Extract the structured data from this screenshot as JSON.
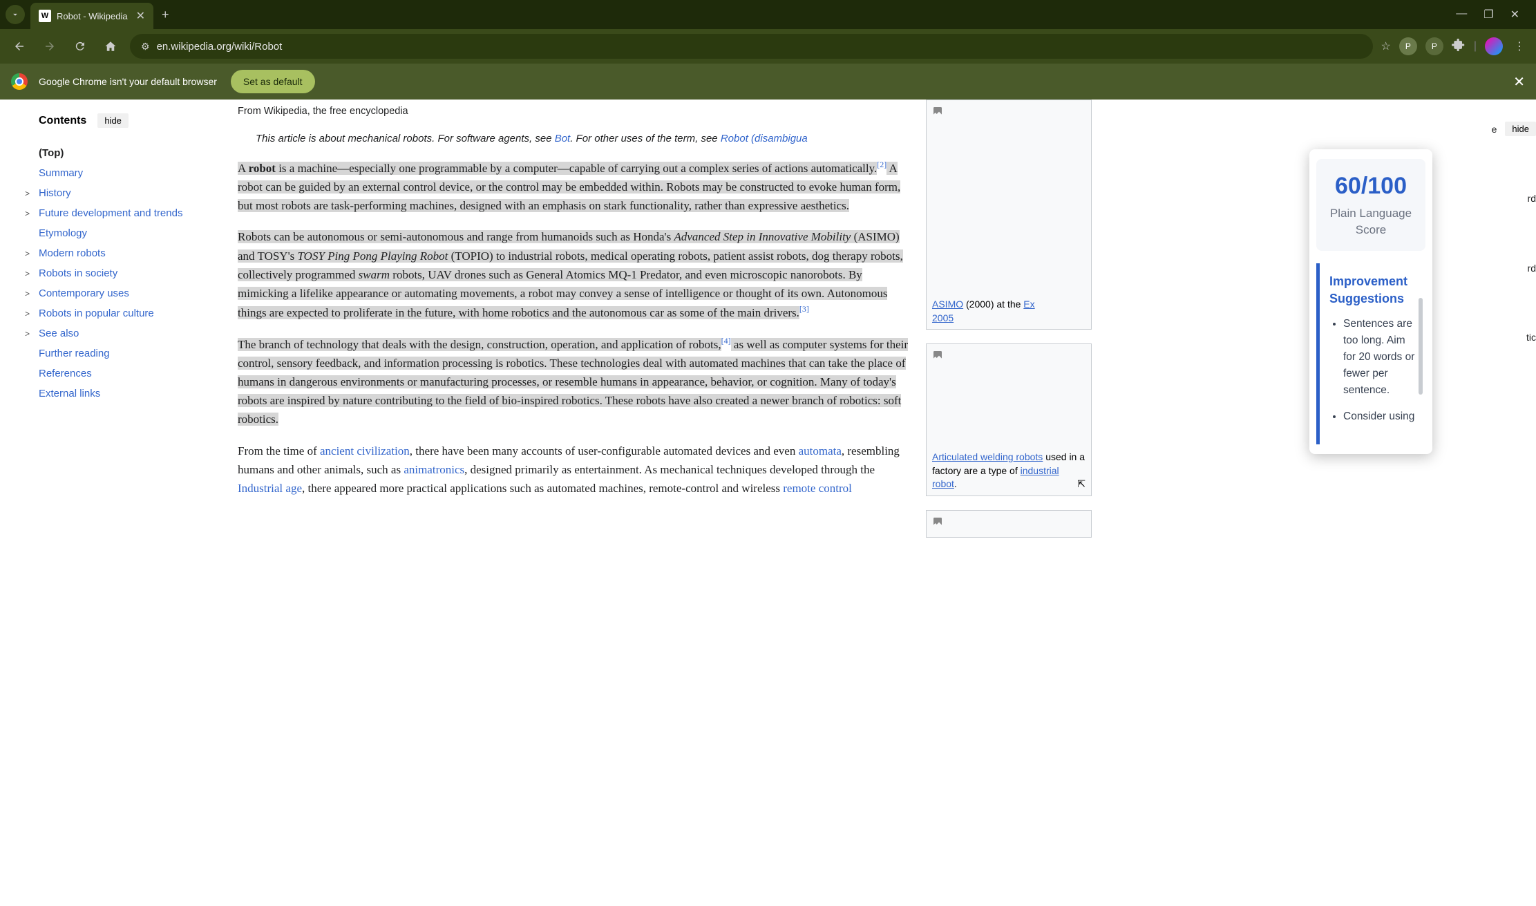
{
  "browser": {
    "tab_title": "Robot - Wikipedia",
    "tab_favicon_letter": "W",
    "url": "en.wikipedia.org/wiki/Robot",
    "profile_letter": "P",
    "window_min": "—",
    "window_max": "⬒",
    "window_close": "✕"
  },
  "infobar": {
    "message": "Google Chrome isn't your default browser",
    "button": "Set as default"
  },
  "toc": {
    "title": "Contents",
    "hide": "hide",
    "items": [
      {
        "label": "(Top)",
        "top": true,
        "chev": false
      },
      {
        "label": "Summary",
        "chev": false
      },
      {
        "label": "History",
        "chev": true
      },
      {
        "label": "Future development and trends",
        "chev": true
      },
      {
        "label": "Etymology",
        "chev": false
      },
      {
        "label": "Modern robots",
        "chev": true
      },
      {
        "label": "Robots in society",
        "chev": true
      },
      {
        "label": "Contemporary uses",
        "chev": true
      },
      {
        "label": "Robots in popular culture",
        "chev": true
      },
      {
        "label": "See also",
        "chev": true
      },
      {
        "label": "Further reading",
        "chev": false
      },
      {
        "label": "References",
        "chev": false
      },
      {
        "label": "External links",
        "chev": false
      }
    ]
  },
  "article": {
    "from_line": "From Wikipedia, the free encyclopedia",
    "hatnote_pre": "This article is about mechanical robots. For software agents, see ",
    "hatnote_link1": "Bot",
    "hatnote_mid": ". For other uses of the term, see ",
    "hatnote_link2": "Robot (disambigua",
    "p1_a": "A ",
    "p1_robot": "robot",
    "p1_b": " is a machine—especially one programmable by a computer—capable of carrying out a complex series of actions automatically.",
    "p1_ref2": "[2]",
    "p1_c": " A robot can be guided by an external control device, or the control may be embedded within. Robots may be constructed to evoke human form, but most robots are task-performing machines, designed with an emphasis on stark functionality, rather than expressive aesthetics.",
    "p2_a": "Robots can be autonomous or semi-autonomous and range from humanoids such as Honda's ",
    "p2_asimo": "Advanced Step in Innovative Mobility",
    "p2_b": " (ASIMO) and TOSY's ",
    "p2_topio": "TOSY Ping Pong Playing Robot",
    "p2_c": " (TOPIO) to industrial robots, medical operating robots, patient assist robots, dog therapy robots, collectively programmed ",
    "p2_swarm": "swarm",
    "p2_d": " robots, UAV drones such as General Atomics MQ-1 Predator, and even microscopic nanorobots. By mimicking a lifelike appearance or automating movements, a robot may convey a sense of intelligence or thought of its own. Autonomous things are expected to proliferate in the future, with home robotics and the autonomous car as some of the main drivers.",
    "p2_ref3": "[3]",
    "p3_a": "The branch of technology that deals with the design, construction, operation, and application of robots,",
    "p3_ref4": "[4]",
    "p3_b": " as well as computer systems for their control, sensory feedback, and information processing is robotics. These technologies deal with automated machines that can take the place of humans in dangerous environments or manufacturing processes, or resemble humans in appearance, behavior, or cognition. Many of today's robots are inspired by nature contributing to the field of bio-inspired robotics. These robots have also created a newer branch of robotics: soft robotics.",
    "p4_a": "From the time of ",
    "p4_link1": "ancient civilization",
    "p4_b": ", there have been many accounts of user-configurable automated devices and even ",
    "p4_link2": "automata",
    "p4_c": ", resembling humans and other animals, such as ",
    "p4_link3": "animatronics",
    "p4_d": ", designed primarily as entertainment. As mechanical techniques developed through the ",
    "p4_link4": "Industrial age",
    "p4_e": ", there appeared more practical applications such as automated machines, remote-control and wireless ",
    "p4_link5": "remote control"
  },
  "infobox": {
    "cap1_link": "ASIMO",
    "cap1_txt": " (2000) at the ",
    "cap1_link2": "Ex",
    "cap1_yr": "2005",
    "cap2_link1": "Articulated welding robots",
    "cap2_txt1": " used in a factory are a type of ",
    "cap2_link2": "industrial robot",
    "cap2_dot": "."
  },
  "right_stubs": {
    "s1": "e",
    "s1_hide": "hide",
    "s2": "rd",
    "s3": "rd",
    "s4": "tic"
  },
  "popup": {
    "score": "60/100",
    "score_label": "Plain Language Score",
    "sugg_title": "Improvement Suggestions",
    "sugg1": "Sentences are too long. Aim for 20 words or fewer per sentence.",
    "sugg2": "Consider using"
  }
}
